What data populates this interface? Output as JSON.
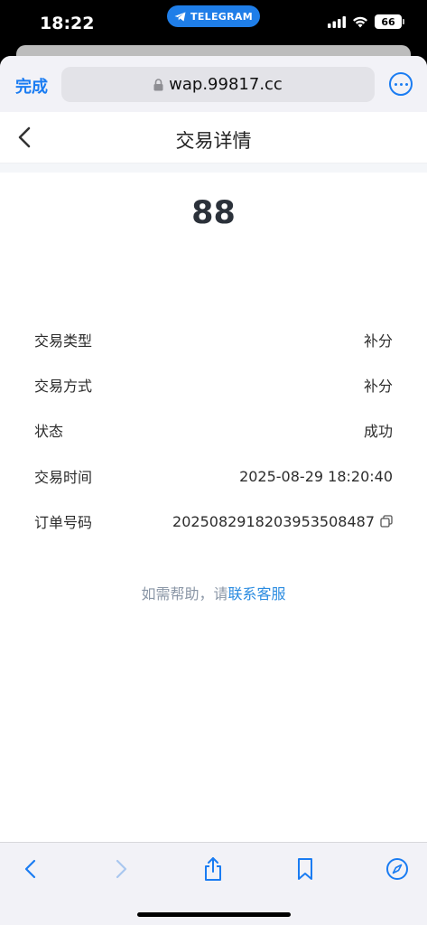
{
  "status_bar": {
    "time": "18:22",
    "telegram_label": "TELEGRAM",
    "battery": "66"
  },
  "browser": {
    "done_label": "完成",
    "url": "wap.99817.cc"
  },
  "page": {
    "title": "交易详情",
    "amount": "88",
    "details": [
      {
        "label": "交易类型",
        "value": "补分"
      },
      {
        "label": "交易方式",
        "value": "补分"
      },
      {
        "label": "状态",
        "value": "成功"
      },
      {
        "label": "交易时间",
        "value": "2025-08-29 18:20:40"
      },
      {
        "label": "订单号码",
        "value": "2025082918203953508487"
      }
    ],
    "help_prefix": "如需帮助，请",
    "help_link": "联系客服"
  },
  "colors": {
    "accent": "#1a7cf2",
    "telegram": "#1f7ee8",
    "link": "#2a8be0"
  },
  "icons": {
    "lock": "lock-icon",
    "copy": "copy-icon",
    "share": "share-icon",
    "bookmark": "bookmark-icon",
    "compass": "compass-icon"
  }
}
